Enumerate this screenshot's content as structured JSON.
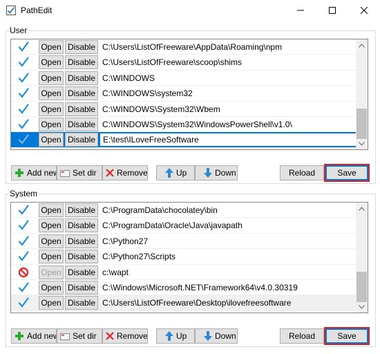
{
  "window": {
    "title": "PathEdit"
  },
  "user": {
    "label": "User",
    "rows": [
      {
        "status": "check",
        "open": "Open",
        "disable": "Disable",
        "path": "C:\\Users\\ListOfFreeware\\AppData\\Roaming\\npm"
      },
      {
        "status": "check",
        "open": "Open",
        "disable": "Disable",
        "path": "C:\\Users\\ListOfFreeware\\scoop\\shims"
      },
      {
        "status": "check",
        "open": "Open",
        "disable": "Disable",
        "path": "C:\\WINDOWS"
      },
      {
        "status": "check",
        "open": "Open",
        "disable": "Disable",
        "path": "C:\\WINDOWS\\system32"
      },
      {
        "status": "check",
        "open": "Open",
        "disable": "Disable",
        "path": "C:\\WINDOWS\\System32\\Wbem"
      },
      {
        "status": "check",
        "open": "Open",
        "disable": "Disable",
        "path": "C:\\WINDOWS\\System32\\WindowsPowerShell\\v1.0\\"
      },
      {
        "status": "check",
        "open": "Open",
        "disable": "Disable",
        "path": "E:\\test\\ILoveFreeSoftware"
      }
    ],
    "toolbar": {
      "add": "Add new",
      "setdir": "Set dir",
      "remove": "Remove",
      "up": "Up",
      "down": "Down",
      "reload": "Reload",
      "save": "Save"
    }
  },
  "system": {
    "label": "System",
    "rows": [
      {
        "status": "check",
        "open": "Open",
        "disable": "Disable",
        "path": "C:\\ProgramData\\chocolatey\\bin"
      },
      {
        "status": "check",
        "open": "Open",
        "disable": "Disable",
        "path": "C:\\ProgramData\\Oracle\\Java\\javapath"
      },
      {
        "status": "check",
        "open": "Open",
        "disable": "Disable",
        "path": "C:\\Python27"
      },
      {
        "status": "check",
        "open": "Open",
        "disable": "Disable",
        "path": "C:\\Python27\\Scripts"
      },
      {
        "status": "blocked",
        "open": "Open",
        "disable": "Disable",
        "path": "c:\\wapt"
      },
      {
        "status": "check",
        "open": "Open",
        "disable": "Disable",
        "path": "C:\\Windows\\Microsoft.NET\\Framework64\\v4.0.30319"
      },
      {
        "status": "check",
        "open": "Open",
        "disable": "Disable",
        "path": "C:\\Users\\ListOfFreeware\\Desktop\\ilovefreesoftware"
      }
    ],
    "toolbar": {
      "add": "Add new",
      "setdir": "Set dir",
      "remove": "Remove",
      "up": "Up",
      "down": "Down",
      "reload": "Reload",
      "save": "Save"
    }
  },
  "colors": {
    "accent": "#0078d7",
    "check": "#1e8fd6",
    "blocked": "#e0201d",
    "highlight": "#e02020"
  }
}
